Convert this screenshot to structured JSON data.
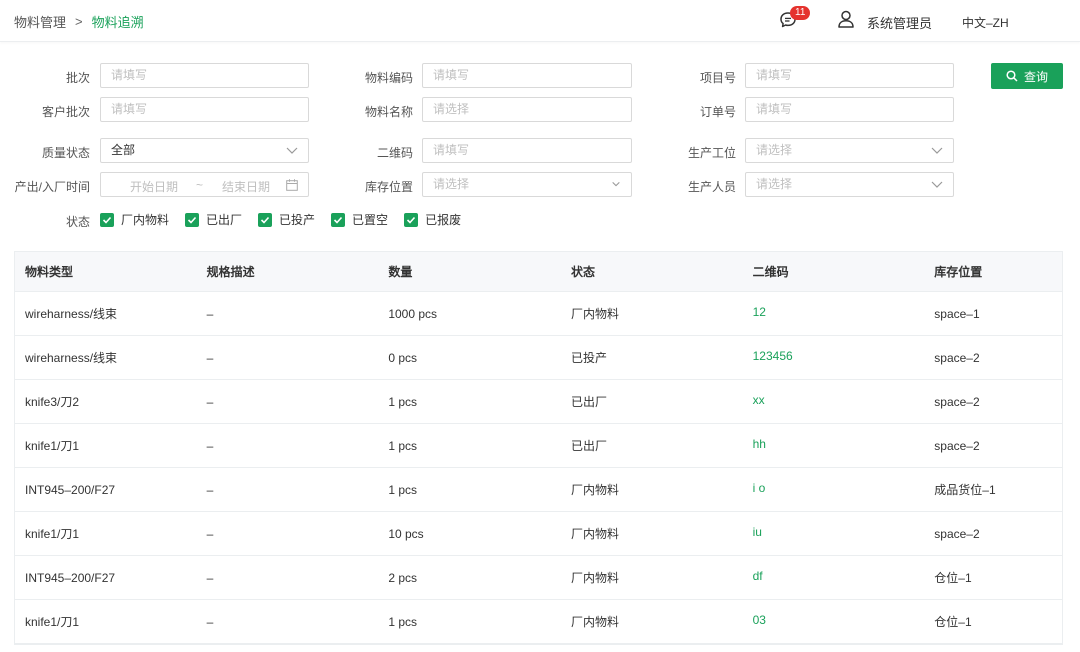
{
  "breadcrumb": {
    "parent": "物料管理",
    "separator": ">",
    "current": "物料追溯"
  },
  "header": {
    "message_count": "11",
    "user_name": "系统管理员",
    "language": "中文–ZH"
  },
  "colors": {
    "accent": "#1aa15a",
    "badge": "#e5322d"
  },
  "filters": {
    "batch": {
      "label": "批次",
      "placeholder": "请填写"
    },
    "material_code": {
      "label": "物料编码",
      "placeholder": "请填写"
    },
    "project_no": {
      "label": "项目号",
      "placeholder": "请填写"
    },
    "customer_batch": {
      "label": "客户批次",
      "placeholder": "请填写"
    },
    "material_name": {
      "label": "物料名称",
      "placeholder": "请选择"
    },
    "order_no": {
      "label": "订单号",
      "placeholder": "请填写"
    },
    "quality_status": {
      "label": "质量状态",
      "value": "全部"
    },
    "qr_code": {
      "label": "二维码",
      "placeholder": "请填写"
    },
    "work_station": {
      "label": "生产工位",
      "placeholder": "请选择"
    },
    "time_range": {
      "label": "产出/入厂时间",
      "start_placeholder": "开始日期",
      "separator": "~",
      "end_placeholder": "结束日期"
    },
    "storage_location": {
      "label": "库存位置",
      "placeholder": "请选择"
    },
    "operator": {
      "label": "生产人员",
      "placeholder": "请选择"
    },
    "status": {
      "label": "状态",
      "options": [
        {
          "label": "厂内物料",
          "checked": true
        },
        {
          "label": "已出厂",
          "checked": true
        },
        {
          "label": "已投产",
          "checked": true
        },
        {
          "label": "已置空",
          "checked": true
        },
        {
          "label": "已报废",
          "checked": true
        }
      ]
    },
    "query_label": "查询"
  },
  "table": {
    "columns": [
      "物料类型",
      "规格描述",
      "数量",
      "状态",
      "二维码",
      "库存位置"
    ],
    "rows": [
      [
        "wireharness/线束",
        "–",
        "1000 pcs",
        "厂内物料",
        "12",
        "space–1"
      ],
      [
        "wireharness/线束",
        "–",
        "0 pcs",
        "已投产",
        "123456",
        "space–2"
      ],
      [
        "knife3/刀2",
        "–",
        "1 pcs",
        "已出厂",
        "xx",
        "space–2"
      ],
      [
        "knife1/刀1",
        "–",
        "1 pcs",
        "已出厂",
        "hh",
        "space–2"
      ],
      [
        "INT945–200/F27",
        "–",
        "1 pcs",
        "厂内物料",
        "i o",
        "成品货位–1"
      ],
      [
        "knife1/刀1",
        "–",
        "10 pcs",
        "厂内物料",
        "iu",
        "space–2"
      ],
      [
        "INT945–200/F27",
        "–",
        "2 pcs",
        "厂内物料",
        "df",
        "仓位–1"
      ],
      [
        "knife1/刀1",
        "–",
        "1 pcs",
        "厂内物料",
        "03",
        "仓位–1"
      ]
    ]
  }
}
